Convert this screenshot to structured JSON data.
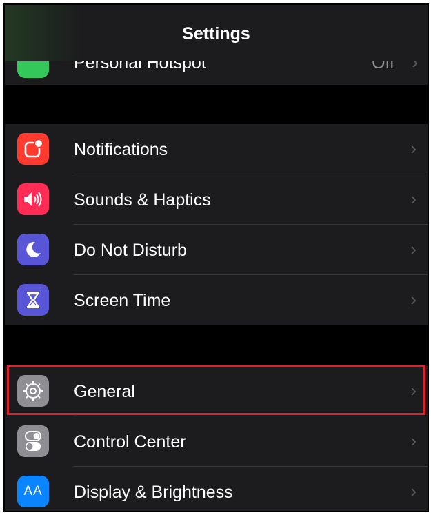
{
  "nav": {
    "title": "Settings"
  },
  "peek_row": {
    "label": "Personal Hotspot",
    "value": "Off",
    "icon": "personal-hotspot-icon",
    "color": "#34c759"
  },
  "groups": [
    {
      "items": [
        {
          "label": "Notifications",
          "icon": "notifications-icon",
          "color": "#ff3b30"
        },
        {
          "label": "Sounds & Haptics",
          "icon": "speaker-icon",
          "color": "#ff2d55"
        },
        {
          "label": "Do Not Disturb",
          "icon": "moon-icon",
          "color": "#5856d6"
        },
        {
          "label": "Screen Time",
          "icon": "hourglass-icon",
          "color": "#5856d6"
        }
      ]
    },
    {
      "items": [
        {
          "label": "General",
          "icon": "gear-icon",
          "color": "#8e8e93",
          "highlighted": true
        },
        {
          "label": "Control Center",
          "icon": "toggles-icon",
          "color": "#8e8e93"
        },
        {
          "label": "Display & Brightness",
          "icon": "text-size-icon",
          "color": "#0a84ff",
          "glyph": "AA"
        }
      ]
    }
  ],
  "chevron": "›",
  "highlight_color": "#e0202a"
}
